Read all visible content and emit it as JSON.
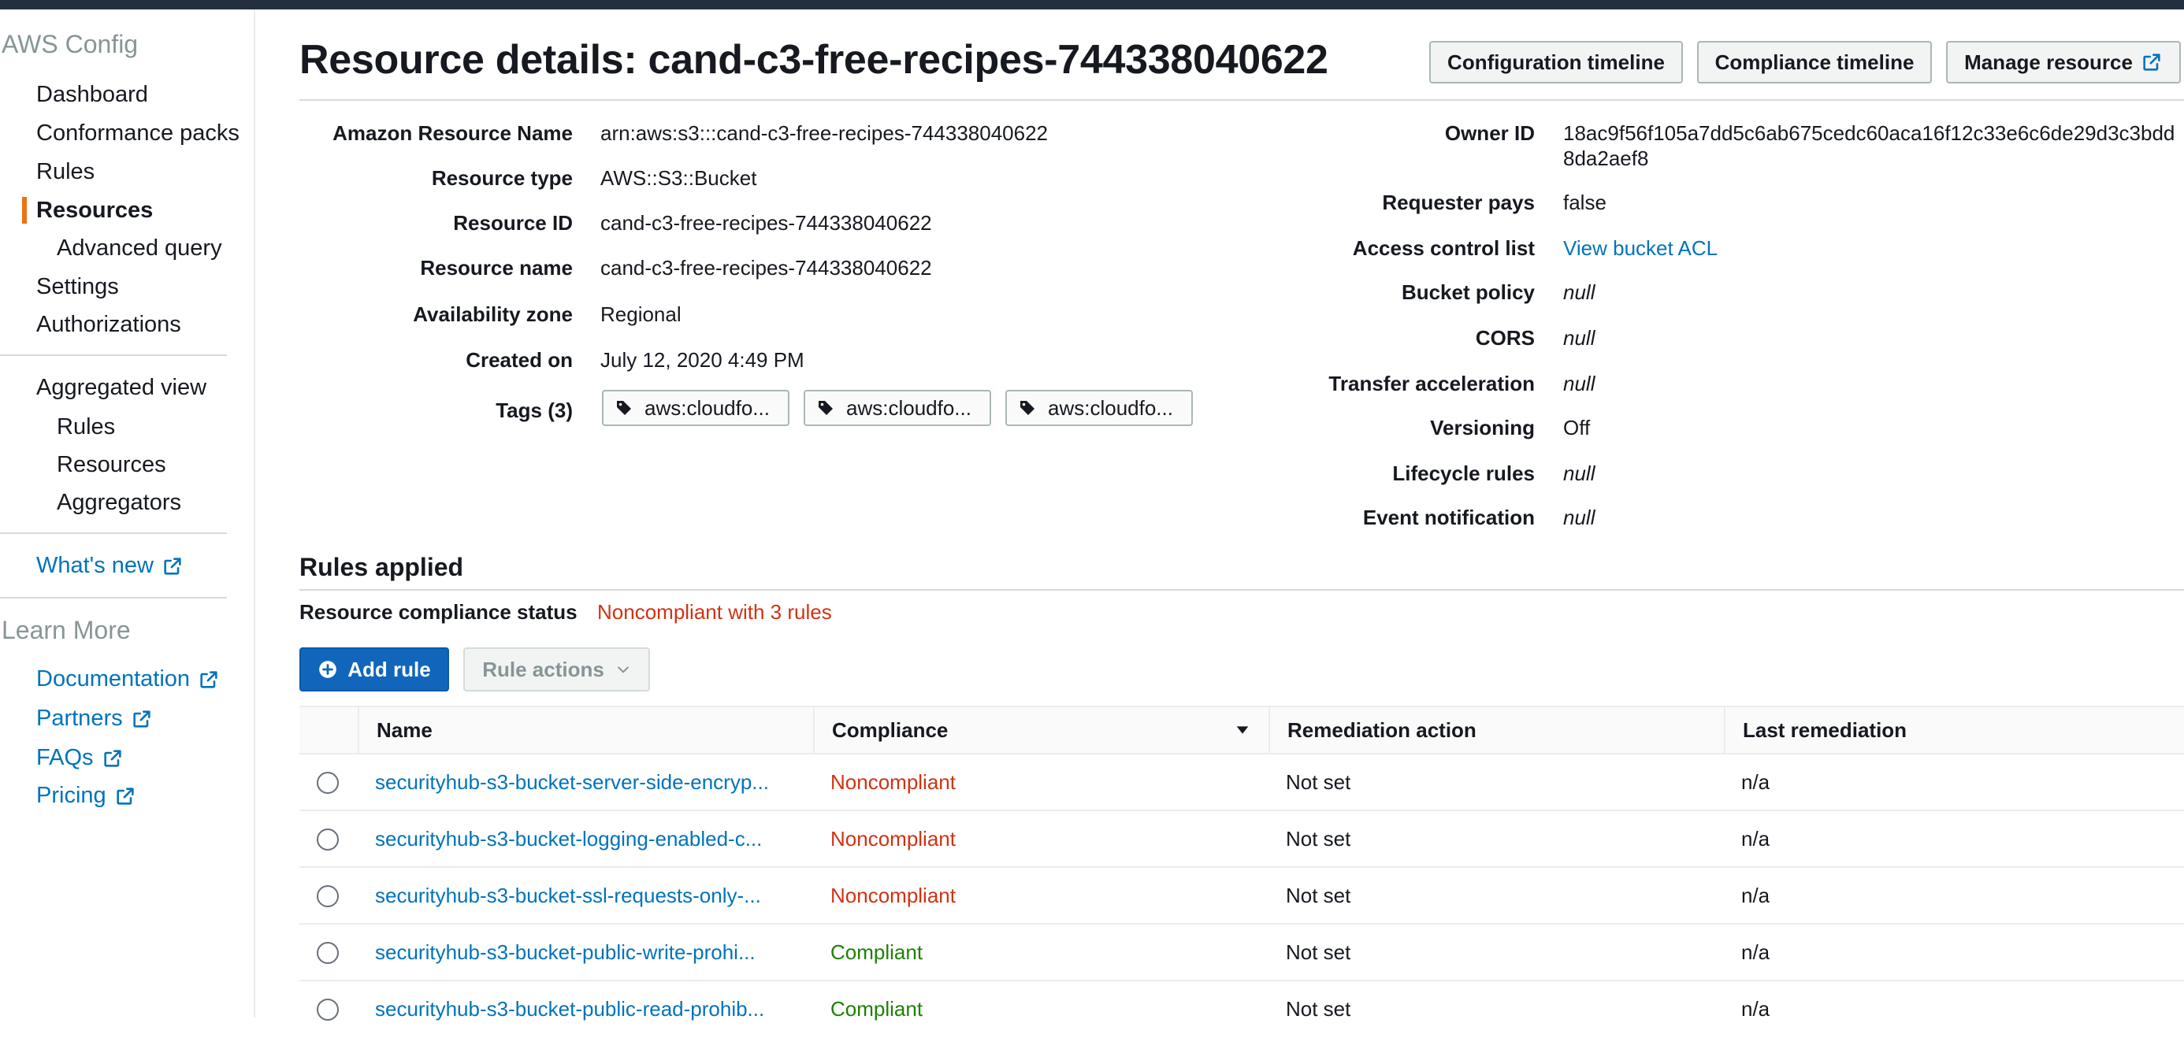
{
  "sidebar": {
    "service_title": "AWS Config",
    "items": [
      {
        "label": "Dashboard"
      },
      {
        "label": "Conformance packs"
      },
      {
        "label": "Rules"
      },
      {
        "label": "Resources"
      },
      {
        "label": "Advanced query"
      },
      {
        "label": "Settings"
      },
      {
        "label": "Authorizations"
      }
    ],
    "aggregated": {
      "label": "Aggregated view",
      "items": [
        {
          "label": "Rules"
        },
        {
          "label": "Resources"
        },
        {
          "label": "Aggregators"
        }
      ]
    },
    "whats_new": "What's new",
    "learn_more": {
      "title": "Learn More",
      "links": [
        {
          "label": "Documentation"
        },
        {
          "label": "Partners"
        },
        {
          "label": "FAQs"
        },
        {
          "label": "Pricing"
        }
      ]
    }
  },
  "header": {
    "title": "Resource details: cand-c3-free-recipes-744338040622",
    "buttons": {
      "config_timeline": "Configuration timeline",
      "compliance_timeline": "Compliance timeline",
      "manage_resource": "Manage resource"
    }
  },
  "details_left": [
    {
      "label": "Amazon Resource Name",
      "value": "arn:aws:s3:::cand-c3-free-recipes-744338040622"
    },
    {
      "label": "Resource type",
      "value": "AWS::S3::Bucket"
    },
    {
      "label": "Resource ID",
      "value": "cand-c3-free-recipes-744338040622"
    },
    {
      "label": "Resource name",
      "value": "cand-c3-free-recipes-744338040622"
    },
    {
      "label": "Availability zone",
      "value": "Regional"
    },
    {
      "label": "Created on",
      "value": "July 12, 2020 4:49 PM"
    }
  ],
  "tags": {
    "label": "Tags (3)",
    "items": [
      "aws:cloudfo...",
      "aws:cloudfo...",
      "aws:cloudfo..."
    ]
  },
  "details_right": {
    "owner_id": {
      "label": "Owner ID",
      "line1": "18ac9f56f105a7dd5c6ab675cedc60aca16f12c33e6c6de29d3c3bdd",
      "line2": "8da2aef8"
    },
    "rows": [
      {
        "label": "Requester pays",
        "value": "false"
      },
      {
        "label": "Access control list",
        "value": "View bucket ACL"
      },
      {
        "label": "Bucket policy",
        "value": "null"
      },
      {
        "label": "CORS",
        "value": "null"
      },
      {
        "label": "Transfer acceleration",
        "value": "null"
      },
      {
        "label": "Versioning",
        "value": "Off"
      },
      {
        "label": "Lifecycle rules",
        "value": "null"
      },
      {
        "label": "Event notification",
        "value": "null"
      }
    ]
  },
  "rules_applied": {
    "title": "Rules applied",
    "status_label": "Resource compliance status",
    "status_value": "Noncompliant with 3 rules",
    "add_rule": "Add rule",
    "rule_actions": "Rule actions",
    "columns": [
      "Name",
      "Compliance",
      "Remediation action",
      "Last remediation"
    ],
    "rows": [
      {
        "name": "securityhub-s3-bucket-server-side-encryp...",
        "compliance": "Noncompliant",
        "remediation": "Not set",
        "last": "n/a"
      },
      {
        "name": "securityhub-s3-bucket-logging-enabled-c...",
        "compliance": "Noncompliant",
        "remediation": "Not set",
        "last": "n/a"
      },
      {
        "name": "securityhub-s3-bucket-ssl-requests-only-...",
        "compliance": "Noncompliant",
        "remediation": "Not set",
        "last": "n/a"
      },
      {
        "name": "securityhub-s3-bucket-public-write-prohi...",
        "compliance": "Compliant",
        "remediation": "Not set",
        "last": "n/a"
      },
      {
        "name": "securityhub-s3-bucket-public-read-prohib...",
        "compliance": "Compliant",
        "remediation": "Not set",
        "last": "n/a"
      }
    ]
  },
  "colors": {
    "link": "#0073bb",
    "noncompliant": "#d13212",
    "compliant": "#1d8102",
    "primary": "#1166bb",
    "active_indicator": "#ec7211",
    "topbar": "#232f3e"
  },
  "icons": {
    "external": "external-link-icon",
    "tag": "tag-icon",
    "add": "plus-circle-icon",
    "caret": "chevron-down-icon",
    "sort": "sort-descending-icon"
  }
}
